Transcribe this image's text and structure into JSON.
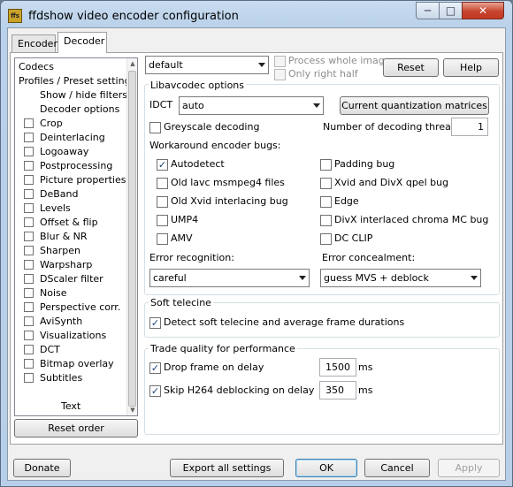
{
  "window": {
    "icon_text": "ffs",
    "title": "ffdshow video encoder configuration"
  },
  "title_buttons": {
    "minimize": "─",
    "maximize": "□",
    "close": "✕"
  },
  "tabs": [
    {
      "label": "Encoder"
    },
    {
      "label": "Decoder"
    }
  ],
  "nav": {
    "header_items": [
      {
        "label": "Codecs"
      },
      {
        "label": "Profiles / Preset settings"
      },
      {
        "label": "Show / hide filters"
      },
      {
        "label": "Decoder options"
      }
    ],
    "filters": [
      {
        "label": "Crop",
        "checked": false
      },
      {
        "label": "Deinterlacing",
        "checked": false
      },
      {
        "label": "Logoaway",
        "checked": false
      },
      {
        "label": "Postprocessing",
        "checked": false
      },
      {
        "label": "Picture properties",
        "checked": false
      },
      {
        "label": "DeBand",
        "checked": false
      },
      {
        "label": "Levels",
        "checked": false
      },
      {
        "label": "Offset & flip",
        "checked": false
      },
      {
        "label": "Blur & NR",
        "checked": false
      },
      {
        "label": "Sharpen",
        "checked": false
      },
      {
        "label": "Warpsharp",
        "checked": false
      },
      {
        "label": "DScaler filter",
        "checked": false
      },
      {
        "label": "Noise",
        "checked": false
      },
      {
        "label": "Perspective corr.",
        "checked": false
      },
      {
        "label": "AviSynth",
        "checked": false
      },
      {
        "label": "Visualizations",
        "checked": false
      },
      {
        "label": "DCT",
        "checked": false
      },
      {
        "label": "Bitmap overlay",
        "checked": false
      },
      {
        "label": "Subtitles",
        "checked": false
      }
    ],
    "partial_item": "Text",
    "reset_order_label": "Reset order"
  },
  "top_controls": {
    "preset_value": "default",
    "process_whole_image_label": "Process whole image",
    "only_right_half_label": "Only right half",
    "reset_label": "Reset",
    "help_label": "Help"
  },
  "libavcodec": {
    "group_title": "Libavcodec options",
    "idct_label": "IDCT",
    "idct_value": "auto",
    "quant_matrices_label": "Current quantization matrices",
    "greyscale_label": "Greyscale decoding",
    "threads_label": "Number of decoding threads:",
    "threads_value": "1",
    "workaround_label": "Workaround encoder bugs:",
    "bugs_left": [
      {
        "label": "Autodetect",
        "checked": true
      },
      {
        "label": "Old lavc msmpeg4 files",
        "checked": false
      },
      {
        "label": "Old Xvid interlacing bug",
        "checked": false
      },
      {
        "label": "UMP4",
        "checked": false
      },
      {
        "label": "AMV",
        "checked": false
      }
    ],
    "bugs_right": [
      {
        "label": "Padding bug",
        "checked": false
      },
      {
        "label": "Xvid and DivX qpel bug",
        "checked": false
      },
      {
        "label": "Edge",
        "checked": false
      },
      {
        "label": "DivX interlaced chroma MC bug",
        "checked": false
      },
      {
        "label": "DC CLIP",
        "checked": false
      }
    ],
    "error_recognition_label": "Error recognition:",
    "error_recognition_value": "careful",
    "error_concealment_label": "Error concealment:",
    "error_concealment_value": "guess MVS + deblock"
  },
  "telecine": {
    "group_title": "Soft telecine",
    "detect_label": "Detect soft telecine and average frame durations",
    "detect_checked": true
  },
  "trade": {
    "group_title": "Trade quality for performance",
    "drop_frame_label": "Drop frame on delay",
    "drop_frame_checked": true,
    "drop_frame_value": "1500",
    "drop_frame_unit": "ms",
    "skip_deblock_label": "Skip H264 deblocking on delay",
    "skip_deblock_checked": true,
    "skip_deblock_value": "350",
    "skip_deblock_unit": "ms"
  },
  "footer": {
    "donate_label": "Donate",
    "export_label": "Export all settings",
    "ok_label": "OK",
    "cancel_label": "Cancel",
    "apply_label": "Apply"
  },
  "colors": {
    "checkmark": "#1b3f7a",
    "title_bar": "#b9d1ea",
    "close_button": "#c7442e"
  }
}
